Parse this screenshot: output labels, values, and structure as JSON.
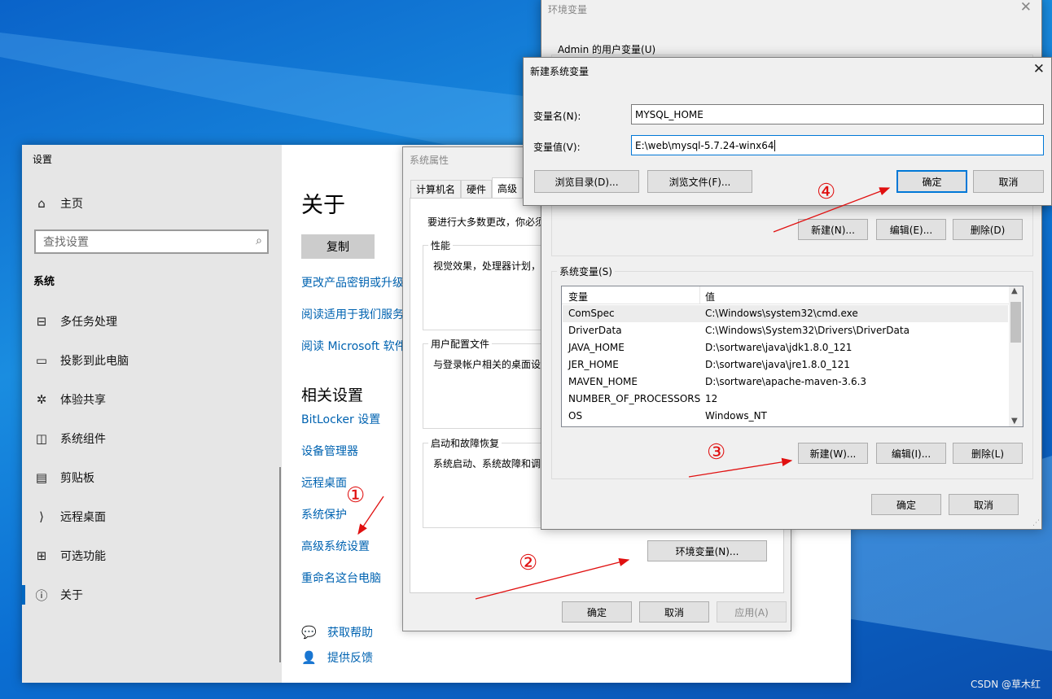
{
  "settings": {
    "window_title": "设置",
    "home": "主页",
    "search_placeholder": "查找设置",
    "section": "系统",
    "nav": [
      {
        "label": "多任务处理",
        "icon": "multitask-icon"
      },
      {
        "label": "投影到此电脑",
        "icon": "project-icon"
      },
      {
        "label": "体验共享",
        "icon": "share-icon"
      },
      {
        "label": "系统组件",
        "icon": "components-icon"
      },
      {
        "label": "剪贴板",
        "icon": "clipboard-icon"
      },
      {
        "label": "远程桌面",
        "icon": "remote-desktop-icon"
      },
      {
        "label": "可选功能",
        "icon": "optional-features-icon"
      },
      {
        "label": "关于",
        "icon": "info-icon"
      }
    ],
    "main_title": "关于",
    "copy_button": "复制",
    "links": [
      "更改产品密钥或升级",
      "阅读适用于我们服务",
      "阅读 Microsoft 软件"
    ],
    "related_title": "相关设置",
    "related_links": [
      "BitLocker 设置",
      "设备管理器",
      "远程桌面",
      "系统保护",
      "高级系统设置",
      "重命名这台电脑"
    ],
    "help": "获取帮助",
    "feedback": "提供反馈"
  },
  "sysprop": {
    "title": "系统属性",
    "tabs": [
      "计算机名",
      "硬件",
      "高级"
    ],
    "intro": "要进行大多数更改，你必须",
    "groups": [
      {
        "label": "性能",
        "text": "视觉效果，处理器计划，"
      },
      {
        "label": "用户配置文件",
        "text": "与登录帐户相关的桌面设"
      },
      {
        "label": "启动和故障恢复",
        "text": "系统启动、系统故障和调"
      }
    ],
    "env_button": "环境变量(N)...",
    "ok": "确定",
    "cancel": "取消",
    "apply": "应用(A)"
  },
  "envvars": {
    "title": "环境变量",
    "user_vars_label": "Admin 的用户变量(U)",
    "user_buttons": {
      "new": "新建(N)...",
      "edit": "编辑(E)...",
      "delete": "删除(D)"
    },
    "sys_vars_label": "系统变量(S)",
    "columns": {
      "var": "变量",
      "value": "值"
    },
    "rows": [
      {
        "name": "ComSpec",
        "value": "C:\\Windows\\system32\\cmd.exe"
      },
      {
        "name": "DriverData",
        "value": "C:\\Windows\\System32\\Drivers\\DriverData"
      },
      {
        "name": "JAVA_HOME",
        "value": "D:\\sortware\\java\\jdk1.8.0_121"
      },
      {
        "name": "JER_HOME",
        "value": "D:\\sortware\\java\\jre1.8.0_121"
      },
      {
        "name": "MAVEN_HOME",
        "value": "D:\\sortware\\apache-maven-3.6.3"
      },
      {
        "name": "NUMBER_OF_PROCESSORS",
        "value": "12"
      },
      {
        "name": "OS",
        "value": "Windows_NT"
      }
    ],
    "sys_buttons": {
      "new": "新建(W)...",
      "edit": "编辑(I)...",
      "delete": "删除(L)"
    },
    "ok": "确定",
    "cancel": "取消"
  },
  "newvar": {
    "title": "新建系统变量",
    "name_label": "变量名(N):",
    "name_value": "MYSQL_HOME",
    "value_label": "变量值(V):",
    "value_value": "E:\\web\\mysql-5.7.24-winx64",
    "browse_dir": "浏览目录(D)...",
    "browse_file": "浏览文件(F)...",
    "ok": "确定",
    "cancel": "取消"
  },
  "annotations": {
    "steps": [
      "①",
      "②",
      "③",
      "④"
    ],
    "color": "#e01010"
  },
  "watermark": "CSDN @草木红"
}
